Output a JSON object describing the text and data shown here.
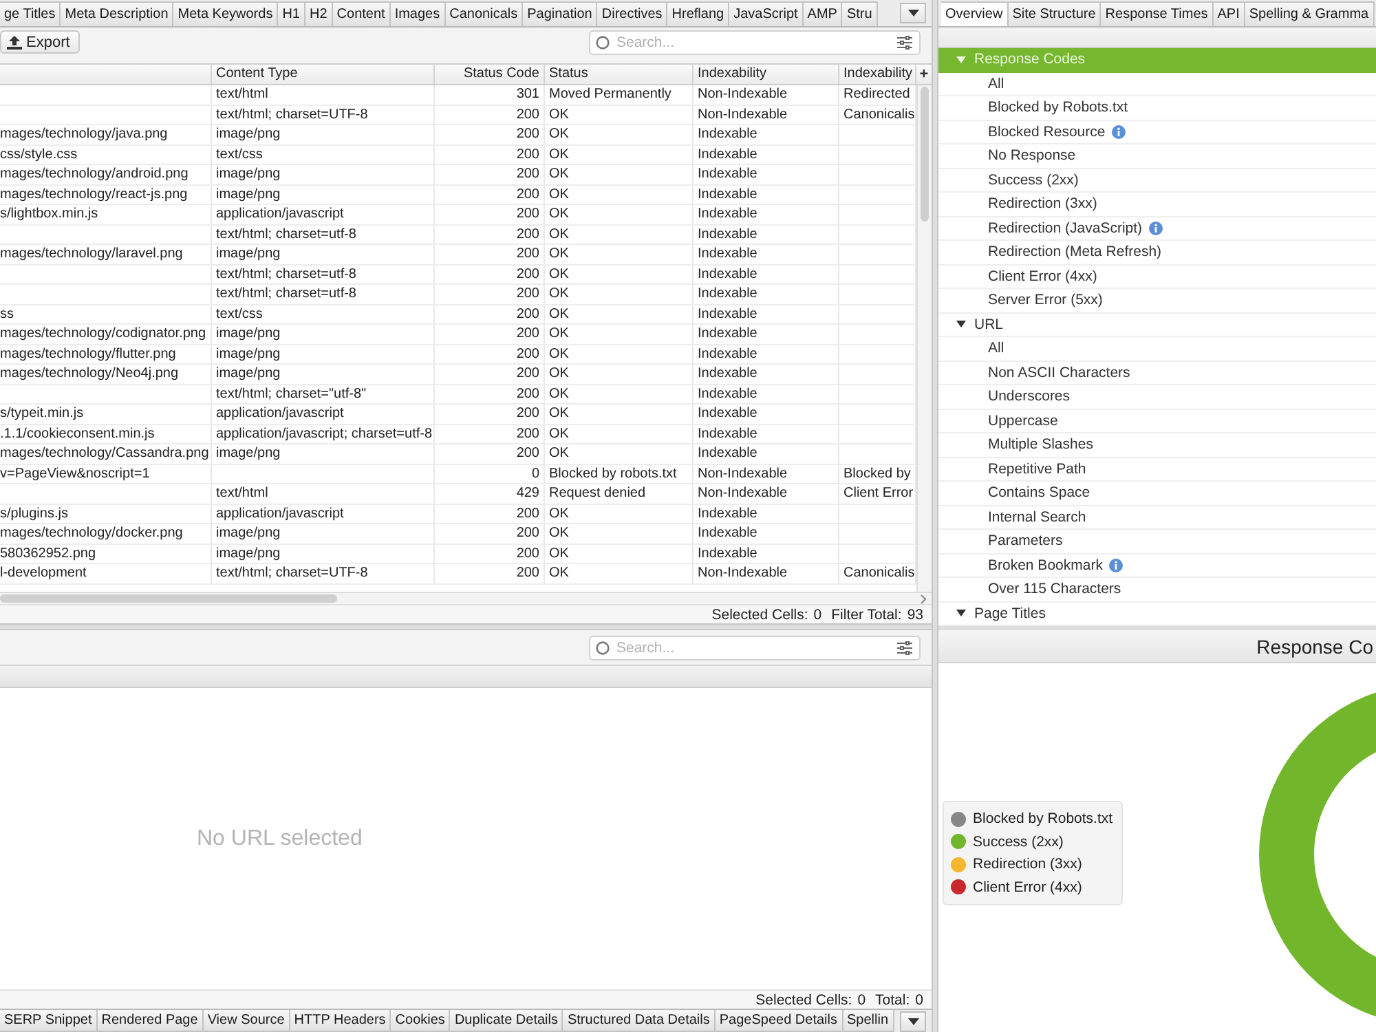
{
  "left_panel": {
    "tabs": [
      {
        "label": "ge Titles",
        "selected": false
      },
      {
        "label": "Meta Description",
        "selected": false
      },
      {
        "label": "Meta Keywords",
        "selected": false
      },
      {
        "label": "H1",
        "selected": false
      },
      {
        "label": "H2",
        "selected": false
      },
      {
        "label": "Content",
        "selected": false
      },
      {
        "label": "Images",
        "selected": false
      },
      {
        "label": "Canonicals",
        "selected": false
      },
      {
        "label": "Pagination",
        "selected": false
      },
      {
        "label": "Directives",
        "selected": false
      },
      {
        "label": "Hreflang",
        "selected": false
      },
      {
        "label": "JavaScript",
        "selected": false
      },
      {
        "label": "AMP",
        "selected": false
      },
      {
        "label": "Stru",
        "selected": false
      }
    ],
    "export_button": "Export",
    "search": {
      "placeholder": "Search..."
    },
    "table": {
      "columns": [
        "Content Type",
        "Status Code",
        "Status",
        "Indexability",
        "Indexability"
      ],
      "add_column_button": "+",
      "rows": [
        {
          "content_type": "text/html",
          "status_code": "301",
          "status": "Moved Permanently",
          "indexability": "Non-Indexable",
          "column_6": "Redirected"
        },
        {
          "content_type": "text/html; charset=UTF-8",
          "status_code": "200",
          "status": "OK",
          "indexability": "Non-Indexable",
          "column_6": "Canonicalis"
        },
        {
          "column_1": "mages/technology/java.png",
          "content_type": "image/png",
          "status_code": "200",
          "status": "OK",
          "indexability": "Indexable"
        },
        {
          "column_1": "css/style.css",
          "content_type": "text/css",
          "status_code": "200",
          "status": "OK",
          "indexability": "Indexable"
        },
        {
          "column_1": "mages/technology/android.png",
          "content_type": "image/png",
          "status_code": "200",
          "status": "OK",
          "indexability": "Indexable"
        },
        {
          "column_1": "mages/technology/react-js.png",
          "content_type": "image/png",
          "status_code": "200",
          "status": "OK",
          "indexability": "Indexable"
        },
        {
          "column_1": "s/lightbox.min.js",
          "content_type": "application/javascript",
          "status_code": "200",
          "status": "OK",
          "indexability": "Indexable"
        },
        {
          "content_type": "text/html; charset=utf-8",
          "status_code": "200",
          "status": "OK",
          "indexability": "Indexable"
        },
        {
          "column_1": "mages/technology/laravel.png",
          "content_type": "image/png",
          "status_code": "200",
          "status": "OK",
          "indexability": "Indexable"
        },
        {
          "content_type": "text/html; charset=utf-8",
          "status_code": "200",
          "status": "OK",
          "indexability": "Indexable"
        },
        {
          "content_type": "text/html; charset=utf-8",
          "status_code": "200",
          "status": "OK",
          "indexability": "Indexable"
        },
        {
          "column_1": "ss",
          "content_type": "text/css",
          "status_code": "200",
          "status": "OK",
          "indexability": "Indexable"
        },
        {
          "column_1": "mages/technology/codignator.png",
          "content_type": "image/png",
          "status_code": "200",
          "status": "OK",
          "indexability": "Indexable"
        },
        {
          "column_1": "mages/technology/flutter.png",
          "content_type": "image/png",
          "status_code": "200",
          "status": "OK",
          "indexability": "Indexable"
        },
        {
          "column_1": "mages/technology/Neo4j.png",
          "content_type": "image/png",
          "status_code": "200",
          "status": "OK",
          "indexability": "Indexable"
        },
        {
          "content_type": "text/html; charset=\"utf-8\"",
          "status_code": "200",
          "status": "OK",
          "indexability": "Indexable"
        },
        {
          "column_1": "s/typeit.min.js",
          "content_type": "application/javascript",
          "status_code": "200",
          "status": "OK",
          "indexability": "Indexable"
        },
        {
          "column_1": ".1.1/cookieconsent.min.js",
          "content_type": "application/javascript; charset=utf-8",
          "status_code": "200",
          "status": "OK",
          "indexability": "Indexable"
        },
        {
          "column_1": "mages/technology/Cassandra.png",
          "content_type": "image/png",
          "status_code": "200",
          "status": "OK",
          "indexability": "Indexable"
        },
        {
          "column_1": "v=PageView&noscript=1",
          "status_code": "0",
          "status": "Blocked by robots.txt",
          "indexability": "Non-Indexable",
          "column_6": "Blocked by"
        },
        {
          "content_type": "text/html",
          "status_code": "429",
          "status": "Request denied",
          "indexability": "Non-Indexable",
          "column_6": "Client Error"
        },
        {
          "column_1": "s/plugins.js",
          "content_type": "application/javascript",
          "status_code": "200",
          "status": "OK",
          "indexability": "Indexable"
        },
        {
          "column_1": "mages/technology/docker.png",
          "content_type": "image/png",
          "status_code": "200",
          "status": "OK",
          "indexability": "Indexable"
        },
        {
          "column_1": "580362952.png",
          "content_type": "image/png",
          "status_code": "200",
          "status": "OK",
          "indexability": "Indexable"
        },
        {
          "column_1": "l-development",
          "content_type": "text/html; charset=UTF-8",
          "status_code": "200",
          "status": "OK",
          "indexability": "Non-Indexable",
          "column_6": "Canonicalis"
        }
      ]
    },
    "status_bar": [
      {
        "label": "Selected Cells:",
        "value": "0"
      },
      {
        "label": "Filter Total:",
        "value": "93"
      }
    ]
  },
  "detail_panel": {
    "search": {
      "placeholder": "Search..."
    },
    "empty_message": "No URL selected",
    "status_bar": [
      {
        "label": "Selected Cells:",
        "value": "0"
      },
      {
        "label": "Total:",
        "value": "0"
      }
    ],
    "tabs": [
      {
        "label": "SERP Snippet",
        "selected": false
      },
      {
        "label": "Rendered Page",
        "selected": false
      },
      {
        "label": "View Source",
        "selected": false
      },
      {
        "label": "HTTP Headers",
        "selected": false
      },
      {
        "label": "Cookies",
        "selected": false
      },
      {
        "label": "Duplicate Details",
        "selected": false
      },
      {
        "label": "Structured Data Details",
        "selected": false
      },
      {
        "label": "PageSpeed Details",
        "selected": false
      },
      {
        "label": "Spellin",
        "selected": false
      }
    ]
  },
  "right_panel": {
    "tabs": [
      {
        "label": "Overview",
        "selected": true
      },
      {
        "label": "Site Structure",
        "selected": false
      },
      {
        "label": "Response Times",
        "selected": false
      },
      {
        "label": "API",
        "selected": false
      },
      {
        "label": "Spelling & Gramma",
        "selected": false
      }
    ],
    "tree": [
      {
        "label": "Response Codes",
        "selected": true,
        "expanded": true,
        "children": [
          {
            "label": "All",
            "selected": false
          },
          {
            "label": "Blocked by Robots.txt",
            "selected": false
          },
          {
            "label": "Blocked Resource",
            "selected": false,
            "info_icon": true
          },
          {
            "label": "No Response",
            "selected": false
          },
          {
            "label": "Success (2xx)",
            "selected": false
          },
          {
            "label": "Redirection (3xx)",
            "selected": false
          },
          {
            "label": "Redirection (JavaScript)",
            "selected": false,
            "info_icon": true
          },
          {
            "label": "Redirection (Meta Refresh)",
            "selected": false
          },
          {
            "label": "Client Error (4xx)",
            "selected": false
          },
          {
            "label": "Server Error (5xx)",
            "selected": false
          }
        ]
      },
      {
        "label": "URL",
        "selected": false,
        "expanded": true,
        "children": [
          {
            "label": "All",
            "selected": false
          },
          {
            "label": "Non ASCII Characters",
            "selected": false
          },
          {
            "label": "Underscores",
            "selected": false
          },
          {
            "label": "Uppercase",
            "selected": false
          },
          {
            "label": "Multiple Slashes",
            "selected": false
          },
          {
            "label": "Repetitive Path",
            "selected": false
          },
          {
            "label": "Contains Space",
            "selected": false
          },
          {
            "label": "Internal Search",
            "selected": false
          },
          {
            "label": "Parameters",
            "selected": false
          },
          {
            "label": "Broken Bookmark",
            "selected": false,
            "info_icon": true
          },
          {
            "label": "Over 115 Characters",
            "selected": false
          }
        ]
      },
      {
        "label": "Page Titles",
        "selected": false,
        "expanded": true
      }
    ]
  },
  "chart_panel": {
    "title": "Response Co",
    "legend": [
      {
        "label": "Blocked by Robots.txt",
        "color": "#878787"
      },
      {
        "label": "Success (2xx)",
        "color": "#72b62c"
      },
      {
        "label": "Redirection (3xx)",
        "color": "#f5b730"
      },
      {
        "label": "Client Error (4xx)",
        "color": "#c9282d"
      }
    ]
  }
}
